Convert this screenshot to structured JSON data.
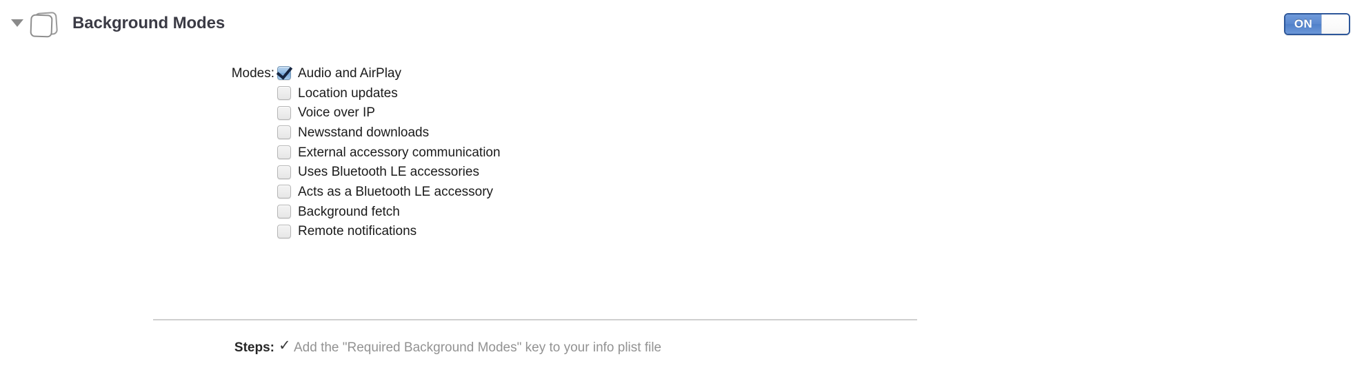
{
  "header": {
    "title": "Background Modes",
    "disclosure_state": "expanded",
    "icon": "stacked-cards-icon",
    "switch": {
      "on_label": "ON",
      "state": "on",
      "on_color": "#5b88cf",
      "border_color": "#2c5699"
    }
  },
  "modes": {
    "label": "Modes:",
    "items": [
      {
        "label": "Audio and AirPlay",
        "checked": true
      },
      {
        "label": "Location updates",
        "checked": false
      },
      {
        "label": "Voice over IP",
        "checked": false
      },
      {
        "label": "Newsstand downloads",
        "checked": false
      },
      {
        "label": "External accessory communication",
        "checked": false
      },
      {
        "label": "Uses Bluetooth LE accessories",
        "checked": false
      },
      {
        "label": "Acts as a Bluetooth LE accessory",
        "checked": false
      },
      {
        "label": "Background fetch",
        "checked": false
      },
      {
        "label": "Remote notifications",
        "checked": false
      }
    ]
  },
  "steps": {
    "label": "Steps:",
    "check_glyph": "✓",
    "text": "Add the \"Required Background Modes\" key to your info plist file",
    "text_color": "#929292"
  }
}
